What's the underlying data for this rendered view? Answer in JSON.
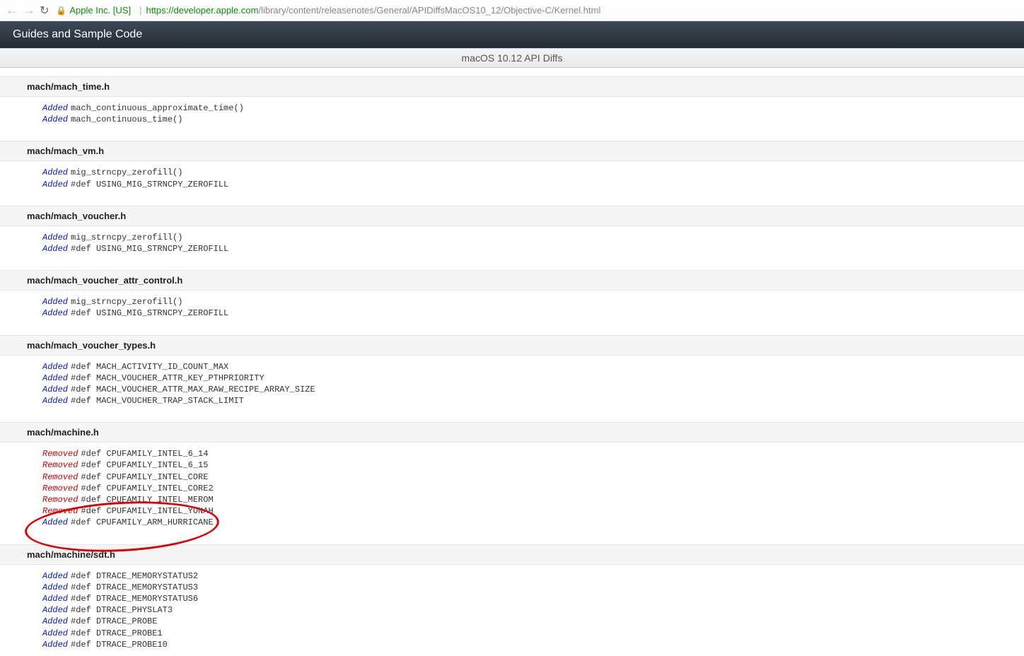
{
  "browser": {
    "company": "Apple Inc. [US]",
    "url_host": "https://developer.apple.com",
    "url_path": "/library/content/releasenotes/General/APIDiffsMacOS10_12/Objective-C/Kernel.html"
  },
  "banner": {
    "title": "Guides and Sample Code"
  },
  "subbanner": {
    "title": "macOS 10.12 API Diffs"
  },
  "sections": [
    {
      "header": "mach/mach_time.h",
      "entries": [
        {
          "kind": "Added",
          "text": "mach_continuous_approximate_time()"
        },
        {
          "kind": "Added",
          "text": "mach_continuous_time()"
        }
      ]
    },
    {
      "header": "mach/mach_vm.h",
      "entries": [
        {
          "kind": "Added",
          "text": "mig_strncpy_zerofill()"
        },
        {
          "kind": "Added",
          "text": "#def USING_MIG_STRNCPY_ZEROFILL"
        }
      ]
    },
    {
      "header": "mach/mach_voucher.h",
      "entries": [
        {
          "kind": "Added",
          "text": "mig_strncpy_zerofill()"
        },
        {
          "kind": "Added",
          "text": "#def USING_MIG_STRNCPY_ZEROFILL"
        }
      ]
    },
    {
      "header": "mach/mach_voucher_attr_control.h",
      "entries": [
        {
          "kind": "Added",
          "text": "mig_strncpy_zerofill()"
        },
        {
          "kind": "Added",
          "text": "#def USING_MIG_STRNCPY_ZEROFILL"
        }
      ]
    },
    {
      "header": "mach/mach_voucher_types.h",
      "entries": [
        {
          "kind": "Added",
          "text": "#def MACH_ACTIVITY_ID_COUNT_MAX"
        },
        {
          "kind": "Added",
          "text": "#def MACH_VOUCHER_ATTR_KEY_PTHPRIORITY"
        },
        {
          "kind": "Added",
          "text": "#def MACH_VOUCHER_ATTR_MAX_RAW_RECIPE_ARRAY_SIZE"
        },
        {
          "kind": "Added",
          "text": "#def MACH_VOUCHER_TRAP_STACK_LIMIT"
        }
      ]
    },
    {
      "header": "mach/machine.h",
      "annotated": true,
      "entries": [
        {
          "kind": "Removed",
          "text": "#def CPUFAMILY_INTEL_6_14"
        },
        {
          "kind": "Removed",
          "text": "#def CPUFAMILY_INTEL_6_15"
        },
        {
          "kind": "Removed",
          "text": "#def CPUFAMILY_INTEL_CORE"
        },
        {
          "kind": "Removed",
          "text": "#def CPUFAMILY_INTEL_CORE2"
        },
        {
          "kind": "Removed",
          "text": "#def CPUFAMILY_INTEL_MEROM"
        },
        {
          "kind": "Removed",
          "text": "#def CPUFAMILY_INTEL_YONAH"
        },
        {
          "kind": "Added",
          "text": "#def CPUFAMILY_ARM_HURRICANE"
        }
      ]
    },
    {
      "header": "mach/machine/sdt.h",
      "entries": [
        {
          "kind": "Added",
          "text": "#def DTRACE_MEMORYSTATUS2"
        },
        {
          "kind": "Added",
          "text": "#def DTRACE_MEMORYSTATUS3"
        },
        {
          "kind": "Added",
          "text": "#def DTRACE_MEMORYSTATUS6"
        },
        {
          "kind": "Added",
          "text": "#def DTRACE_PHYSLAT3"
        },
        {
          "kind": "Added",
          "text": "#def DTRACE_PROBE"
        },
        {
          "kind": "Added",
          "text": "#def DTRACE_PROBE1"
        },
        {
          "kind": "Added",
          "text": "#def DTRACE_PROBE10"
        }
      ]
    }
  ]
}
